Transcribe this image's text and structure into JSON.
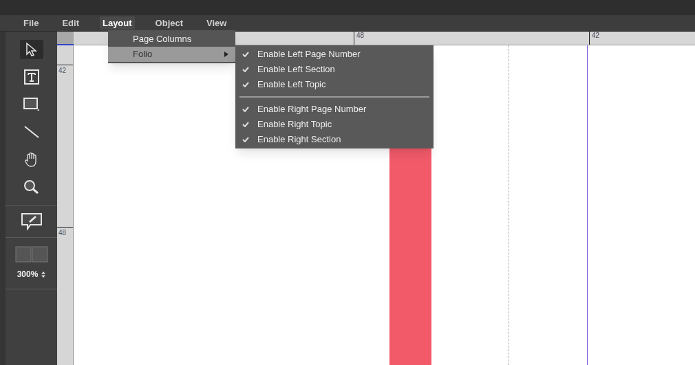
{
  "menu_bar": [
    {
      "label": "File",
      "selected": false
    },
    {
      "label": "Edit",
      "selected": false
    },
    {
      "label": "Layout",
      "selected": true
    },
    {
      "label": "Object",
      "selected": false
    },
    {
      "label": "View",
      "selected": false
    }
  ],
  "layout_menu": [
    {
      "label": "Page Columns",
      "selected": false,
      "has_submenu": false
    },
    {
      "label": "Folio",
      "selected": true,
      "has_submenu": true
    }
  ],
  "folio_submenu": [
    {
      "kind": "item",
      "label": "Enable Left Page Number",
      "checked": true
    },
    {
      "kind": "item",
      "label": "Enable Left Section",
      "checked": true
    },
    {
      "kind": "item",
      "label": "Enable Left Topic",
      "checked": true
    },
    {
      "kind": "separator"
    },
    {
      "kind": "item",
      "label": "Enable Right Page Number",
      "checked": true
    },
    {
      "kind": "item",
      "label": "Enable Right Topic",
      "checked": true
    },
    {
      "kind": "item",
      "label": "Enable Right Section",
      "checked": true
    }
  ],
  "tools": [
    {
      "kind": "select",
      "selected": true
    },
    {
      "kind": "text",
      "selected": false
    },
    {
      "kind": "rectangle",
      "selected": false
    },
    {
      "kind": "line",
      "selected": false
    },
    {
      "kind": "hand",
      "selected": false
    },
    {
      "kind": "zoom",
      "selected": false
    }
  ],
  "zoom_level": "300%",
  "horizontal_ruler": [
    "48",
    "42"
  ],
  "vertical_ruler": [
    "42",
    "48"
  ]
}
